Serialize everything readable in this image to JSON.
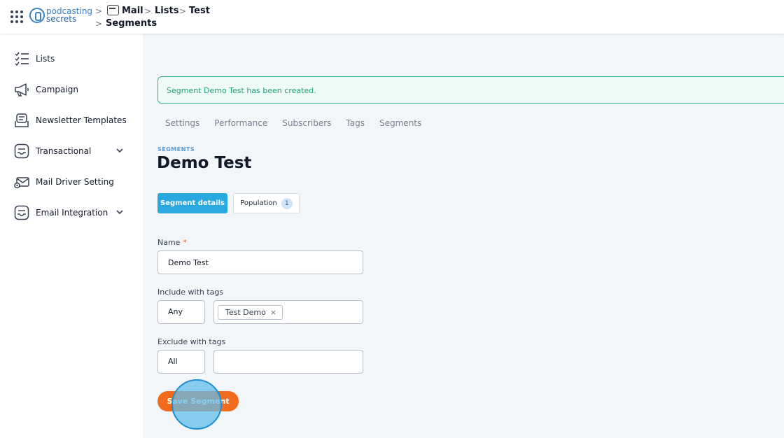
{
  "header": {
    "logo_line1": "podcasting",
    "logo_line2": "secrets",
    "breadcrumb": {
      "mail": "Mail",
      "lists": "Lists",
      "test": "Test",
      "segments": "Segments",
      "separator": ">"
    }
  },
  "sidebar": {
    "items": [
      {
        "label": "Lists"
      },
      {
        "label": "Campaign"
      },
      {
        "label": "Newsletter Templates"
      },
      {
        "label": "Transactional"
      },
      {
        "label": "Mail Driver Setting"
      },
      {
        "label": "Email Integration"
      }
    ]
  },
  "alert": {
    "message": "Segment Demo Test has been created.",
    "color": "#34b28f"
  },
  "tabs": [
    "Settings",
    "Performance",
    "Subscribers",
    "Tags",
    "Segments"
  ],
  "page": {
    "kicker": "SEGMENTS",
    "title": "Demo Test"
  },
  "subtabs": {
    "details": "Segment details",
    "population": "Population",
    "population_count": "1"
  },
  "form": {
    "name_label": "Name",
    "required_mark": "*",
    "name_value": "Demo Test",
    "include_label": "Include with tags",
    "include_match": "Any",
    "include_tag": "Test Demo",
    "tag_remove": "×",
    "exclude_label": "Exclude with tags",
    "exclude_match": "All",
    "save_label": "Save Segment"
  },
  "colors": {
    "primary": "#2aa8e0",
    "save": "#f26a1b",
    "kicker": "#5a9bd5"
  }
}
